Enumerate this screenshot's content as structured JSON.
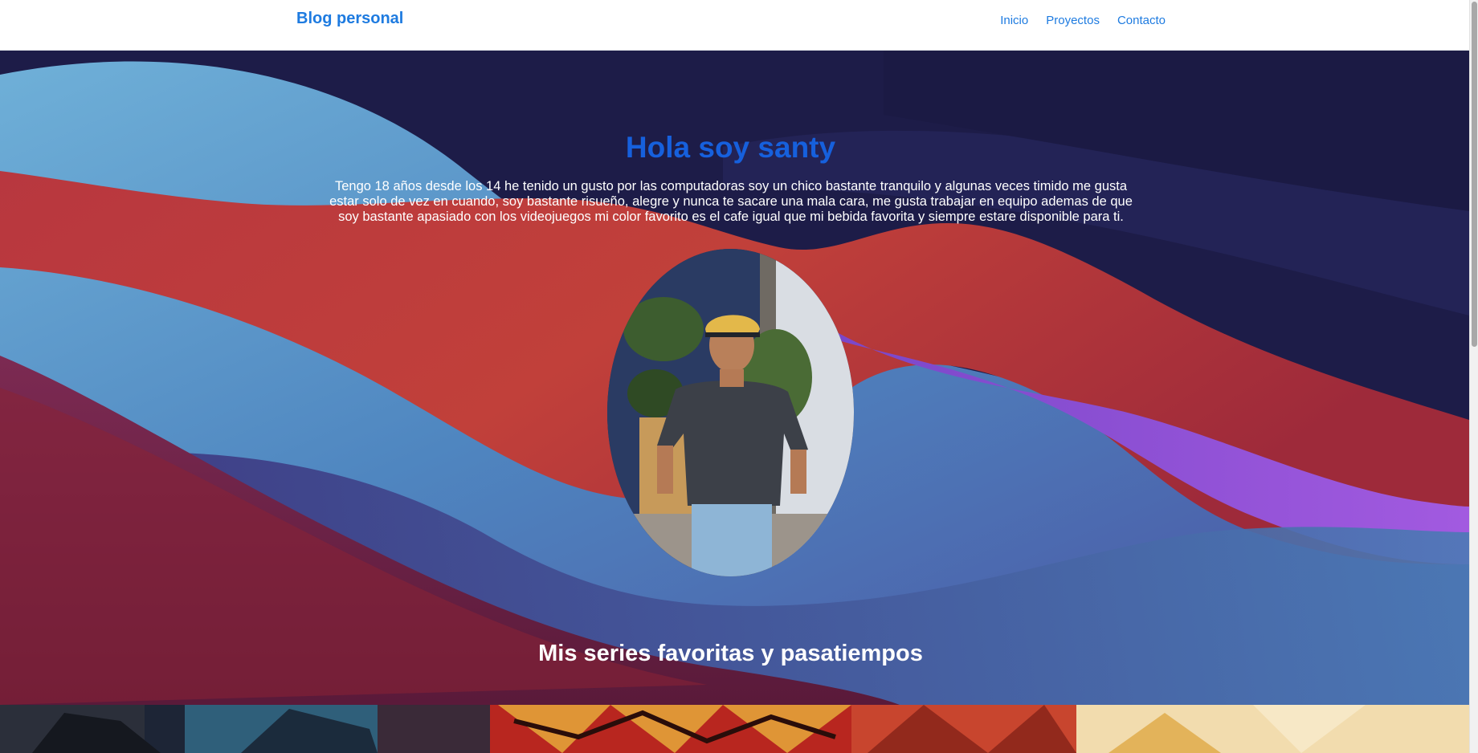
{
  "navbar": {
    "brand": "Blog personal",
    "links": [
      {
        "label": "Inicio"
      },
      {
        "label": "Proyectos"
      },
      {
        "label": "Contacto"
      }
    ]
  },
  "hero": {
    "title": "Hola soy santy",
    "description": "Tengo 18 años desde los 14 he tenido un gusto por las computadoras soy un chico bastante tranquilo y algunas veces timido me gusta estar solo de vez en cuando, soy bastante risueño, alegre y nunca te sacare una mala cara, me gusta trabajar en equipo ademas de que soy bastante apasiado con los videojuegos mi color favorito es el cafe igual que mi bebida favorita y siempre estare disponible para ti.",
    "section_title": "Mis series favoritas y pasatiempos"
  },
  "colors": {
    "link": "#1e7be0",
    "title": "#1660dd",
    "hero_bg": "#1b1b45"
  }
}
